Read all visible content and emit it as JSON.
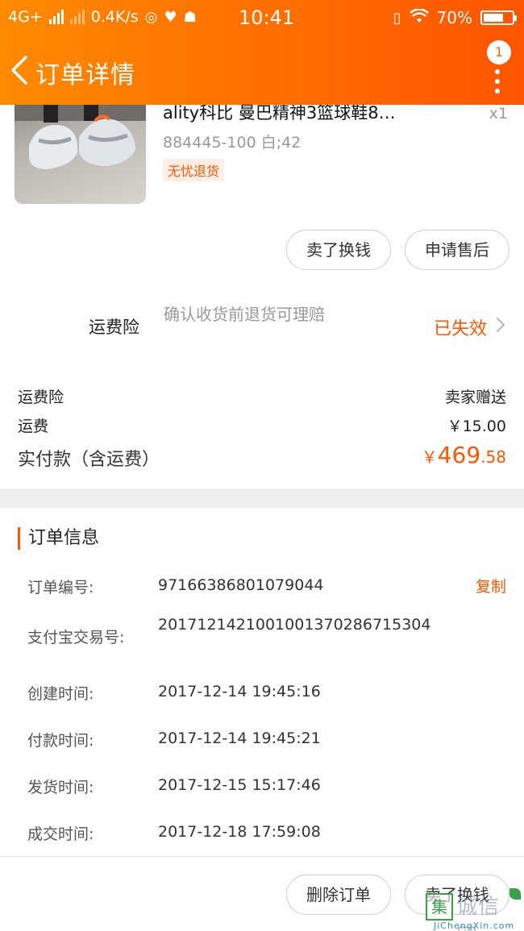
{
  "status_bar": {
    "network": "4G+",
    "speed": "0.4K/s",
    "time": "10:41",
    "battery": "70%",
    "battery_level_fraction": 0.7
  },
  "nav": {
    "title": "订单详情",
    "badge_count": "1"
  },
  "product": {
    "title": "ality科比 曼巴精神3篮球鞋8…",
    "quantity": "x1",
    "sku": "884445-100 白;42",
    "tag": "无忧退货",
    "actions": [
      "卖了换钱",
      "申请售后"
    ]
  },
  "insurance": {
    "label": "运费险",
    "description": "确认收货前退货可理赔",
    "status": "已失效"
  },
  "summary": {
    "rows": [
      {
        "label": "运费险",
        "value": "卖家赠送"
      },
      {
        "label": "运费",
        "value": "￥15.00"
      }
    ],
    "paid_label": "实付款（含运费）",
    "paid_currency": "￥",
    "paid_integer": "469",
    "paid_decimal": ".58"
  },
  "order_info": {
    "section_title": "订单信息",
    "copy_label": "复制",
    "fields": [
      {
        "label": "订单编号:",
        "value": "97166386801079044"
      },
      {
        "label": "支付宝交易号:",
        "value": "2017121421001001370286715304"
      },
      {
        "label": "创建时间:",
        "value": "2017-12-14 19:45:16"
      },
      {
        "label": "付款时间:",
        "value": "2017-12-14 19:45:21"
      },
      {
        "label": "发货时间:",
        "value": "2017-12-15 15:17:46"
      },
      {
        "label": "成交时间:",
        "value": "2017-12-18 17:59:08"
      }
    ]
  },
  "bottom_actions": [
    "删除订单",
    "卖了换钱"
  ],
  "watermark": {
    "box_char": "集",
    "text": "诚信网",
    "sub": "JiChengXin.com"
  }
}
